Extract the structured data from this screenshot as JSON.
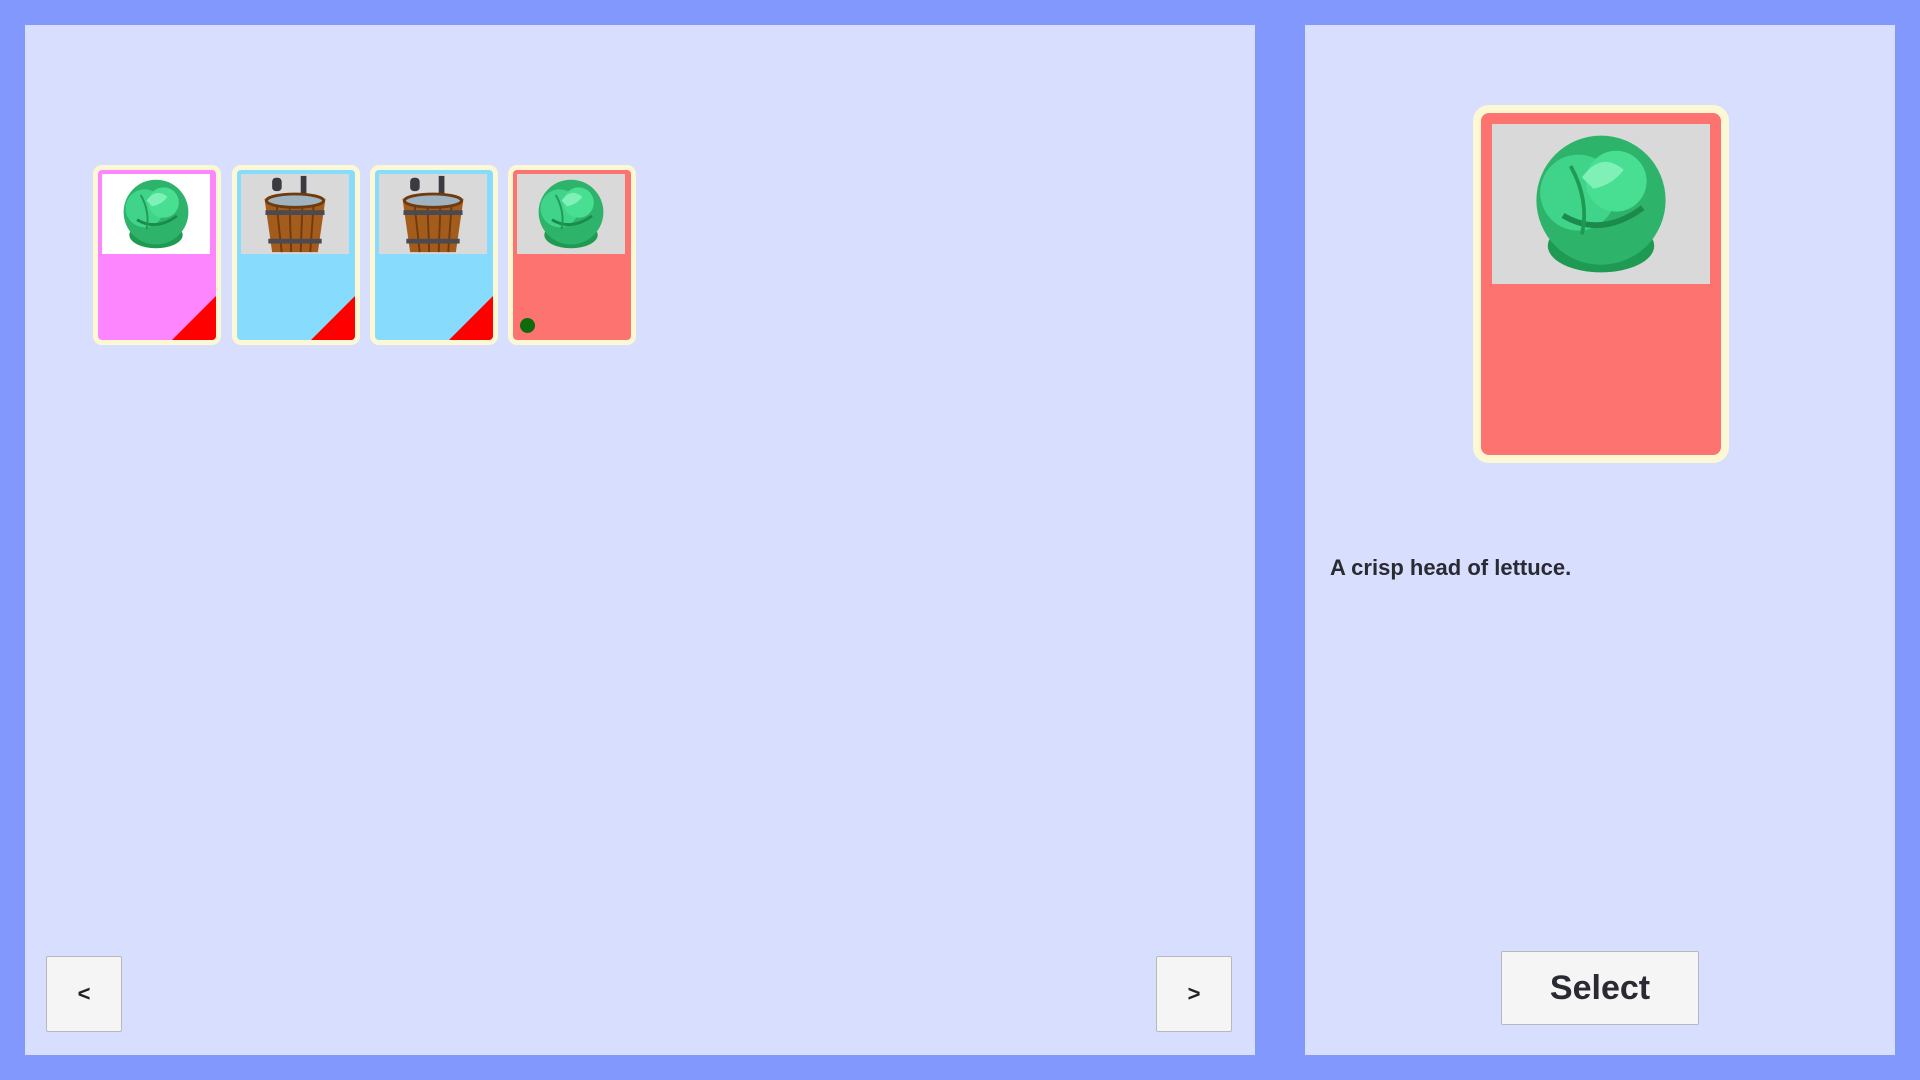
{
  "hand": {
    "cards": [
      {
        "item": "lettuce",
        "icon": "lettuce-icon",
        "card_color": "#fd85fd",
        "art_background": "#ffffff",
        "corner_flag": true,
        "corner_color": "#ff0000",
        "dot": false
      },
      {
        "item": "water-bucket",
        "icon": "water-bucket-icon",
        "card_color": "#87dbfd",
        "art_background": "#d9d9d9",
        "corner_flag": true,
        "corner_color": "#ff0000",
        "dot": false
      },
      {
        "item": "water-bucket",
        "icon": "water-bucket-icon",
        "card_color": "#87dbfd",
        "art_background": "#d9d9d9",
        "corner_flag": true,
        "corner_color": "#ff0000",
        "dot": false
      },
      {
        "item": "lettuce",
        "icon": "lettuce-icon",
        "card_color": "#fd7370",
        "art_background": "#d9d9d9",
        "corner_flag": false,
        "dot": true,
        "dot_color": "#0d6b0d"
      }
    ]
  },
  "navigation": {
    "prev_label": "<",
    "next_label": ">"
  },
  "detail": {
    "card_icon": "lettuce-icon",
    "card_color": "#fd7370",
    "description": "A crisp head of lettuce.",
    "select_label": "Select"
  },
  "colors": {
    "background": "#8298fc",
    "panel": "#d8defd",
    "card_border": "#fdf8d4"
  }
}
